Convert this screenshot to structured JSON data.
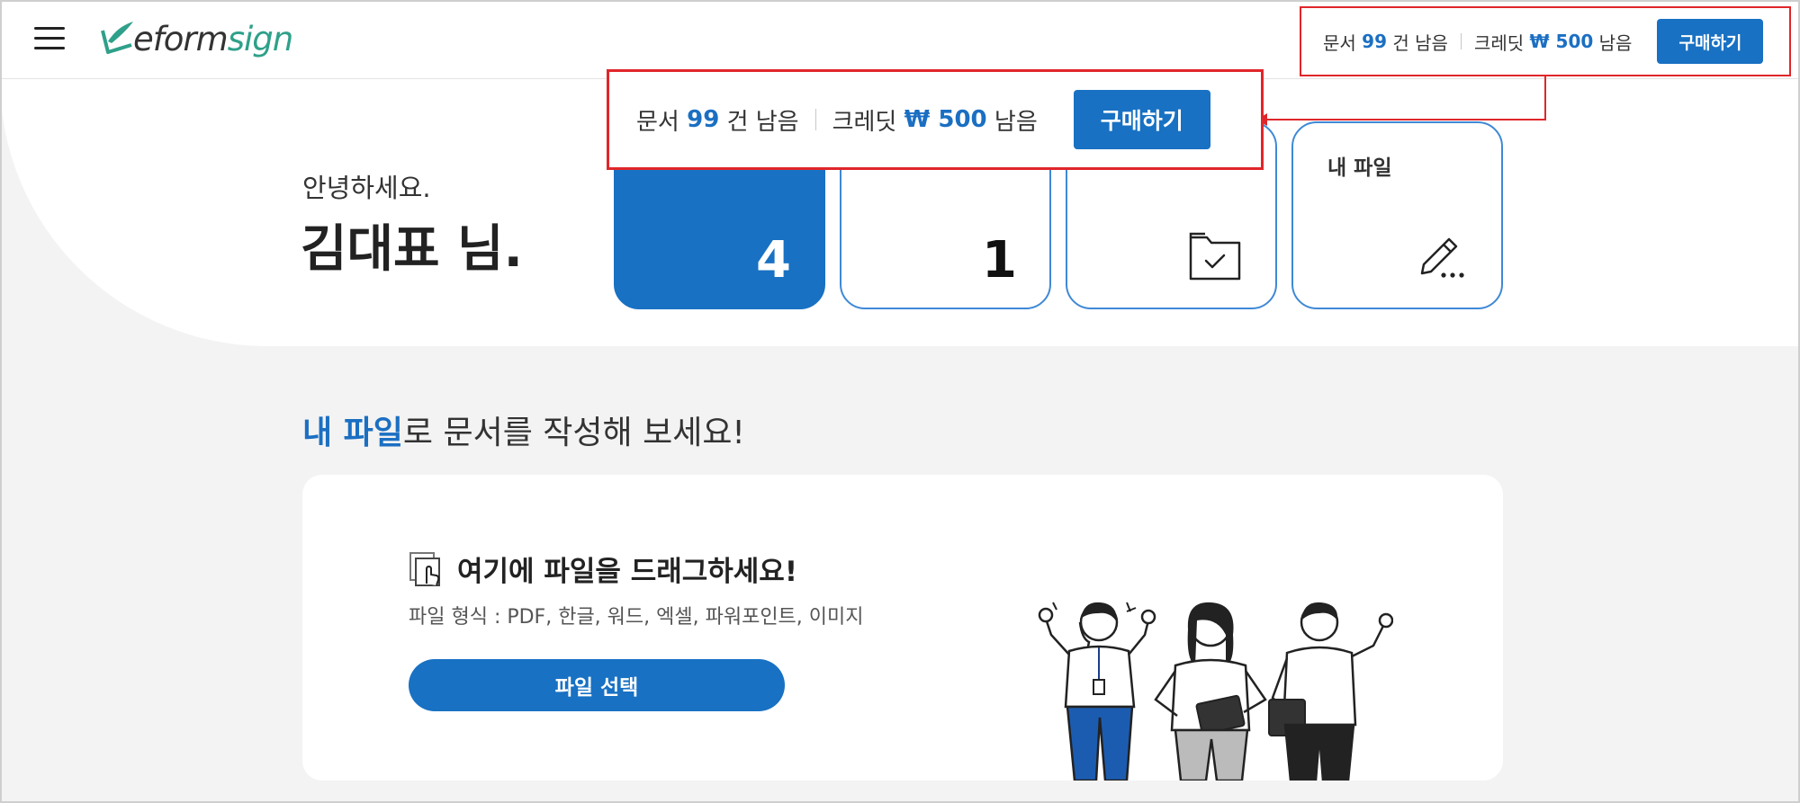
{
  "app": {
    "logo_text_a": "eform",
    "logo_text_b": "sign"
  },
  "header": {
    "doc_prefix": "문서",
    "doc_count": "99",
    "doc_suffix": "건 남음",
    "credit_prefix": "크레딧",
    "credit_value": "₩ 500",
    "credit_suffix": "남음",
    "buy_label": "구매하기"
  },
  "callout": {
    "doc_prefix": "문서",
    "doc_count": "99",
    "doc_suffix": "건 남음",
    "credit_prefix": "크레딧",
    "credit_value": "₩ 500",
    "credit_suffix": "남음",
    "buy_label": "구매하기"
  },
  "greeting": {
    "line1": "안녕하세요.",
    "name": "김대표 님."
  },
  "cards": [
    {
      "label": "",
      "count": "4"
    },
    {
      "label": "",
      "count": "1"
    },
    {
      "label": "",
      "icon": "folder-check-icon"
    },
    {
      "label": "내 파일",
      "icon": "pencil-more-icon"
    }
  ],
  "section": {
    "title_highlight": "내 파일",
    "title_rest": "로 문서를 작성해 보세요!"
  },
  "upload": {
    "drag_text": "여기에 파일을 드래그하세요!",
    "formats": "파일 형식 : PDF, 한글, 워드, 엑셀, 파워포인트, 이미지",
    "button_label": "파일 선택"
  },
  "colors": {
    "accent": "#1871c3",
    "highlight_border": "#e0262a",
    "brand_green": "#2fa08a"
  }
}
